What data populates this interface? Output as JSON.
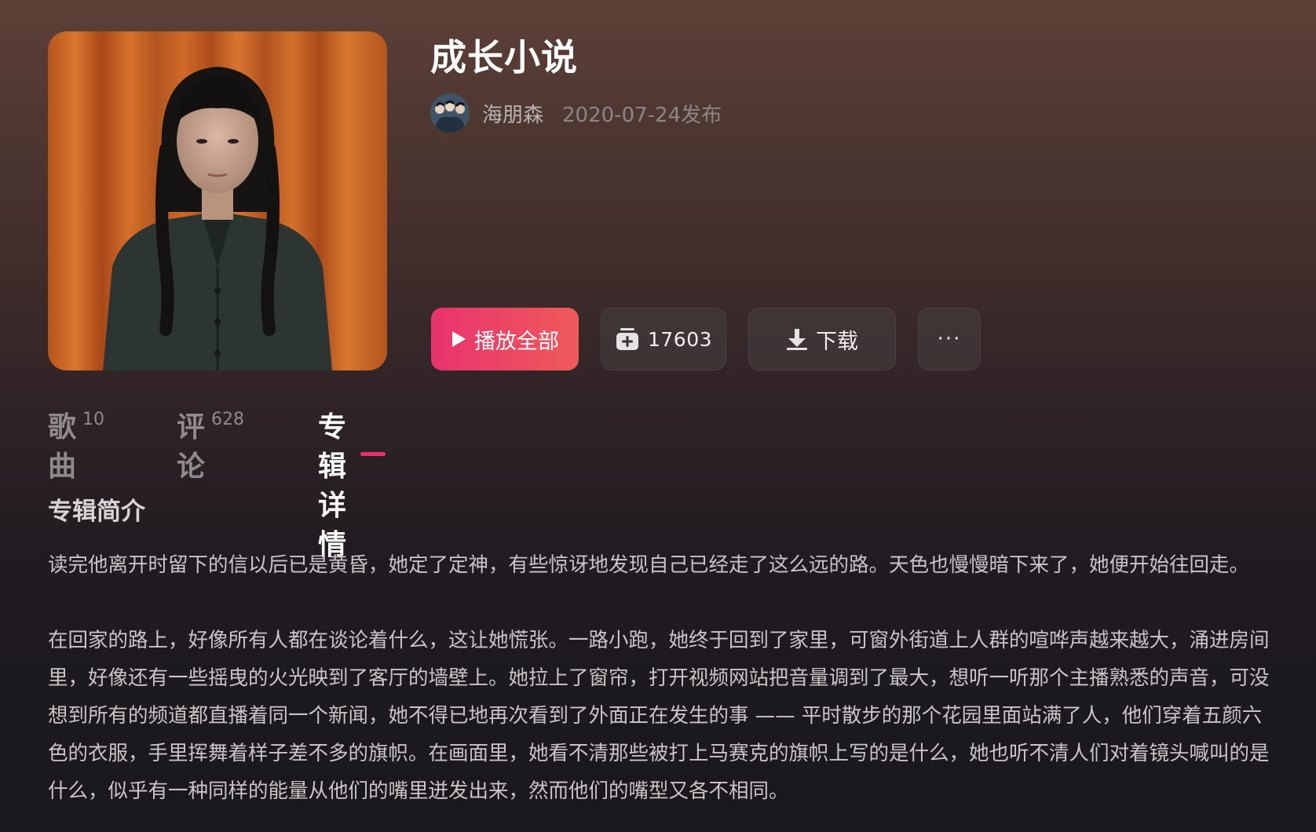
{
  "album": {
    "title": "成长小说",
    "artist": "海朋森",
    "release_date": "2020-07-24发布"
  },
  "actions": {
    "play_all_label": "播放全部",
    "collect_count": "17603",
    "download_label": "下载",
    "more_label": "···"
  },
  "tabs": [
    {
      "label": "歌曲",
      "count": "10"
    },
    {
      "label": "评论",
      "count": "628"
    },
    {
      "label": "专辑详情",
      "count": ""
    }
  ],
  "active_tab": "专辑详情",
  "details": {
    "heading": "专辑简介",
    "paragraphs": [
      "读完他离开时留下的信以后已是黄昏，她定了定神，有些惊讶地发现自己已经走了这么远的路。天色也慢慢暗下来了，她便开始往回走。",
      "在回家的路上，好像所有人都在谈论着什么，这让她慌张。一路小跑，她终于回到了家里，可窗外街道上人群的喧哗声越来越大，涌进房间里，好像还有一些摇曳的火光映到了客厅的墙壁上。她拉上了窗帘，打开视频网站把音量调到了最大，想听一听那个主播熟悉的声音，可没想到所有的频道都直播着同一个新闻，她不得已地再次看到了外面正在发生的事 —— 平时散步的那个花园里面站满了人，他们穿着五颜六色的衣服，手里挥舞着样子差不多的旗帜。在画面里，她看不清那些被打上马赛克的旗帜上写的是什么，她也听不清人们对着镜头喊叫的是什么，似乎有一种同样的能量从他们的嘴里迸发出来，然而他们的嘴型又各不相同。"
    ]
  },
  "icons": {
    "play": "play-icon",
    "collect": "add-to-collection-icon",
    "download": "download-icon",
    "more": "more-icon"
  },
  "colors": {
    "accent": "#e8336e",
    "accent_end": "#ef5a5a",
    "background_top": "#5c4038",
    "background_bottom": "#1a181c"
  }
}
